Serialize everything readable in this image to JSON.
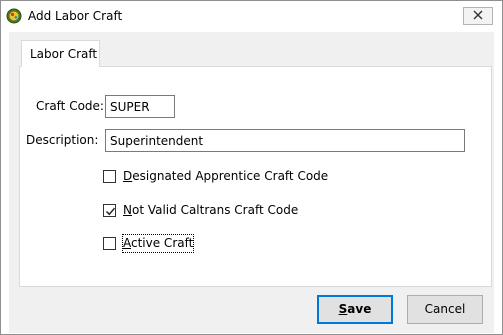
{
  "window": {
    "title": "Add Labor Craft",
    "app_icon": "app-icon",
    "close_icon": "close-icon"
  },
  "tabs": [
    {
      "label": "Labor Craft",
      "selected": true
    }
  ],
  "form": {
    "craft_code": {
      "label": "Craft Code:",
      "value": "SUPER"
    },
    "description": {
      "label": "Description:",
      "value": "Superintendent"
    },
    "checkboxes": [
      {
        "label_mnemonic": "D",
        "label_rest": "esignated Apprentice Craft Code",
        "checked": false
      },
      {
        "label_mnemonic": "N",
        "label_rest": "ot Valid Caltrans Craft Code",
        "checked": true
      },
      {
        "label_mnemonic": "A",
        "label_rest": "ctive Craft",
        "checked": false,
        "focused": true
      }
    ]
  },
  "buttons": {
    "save_mnemonic": "S",
    "save_rest": "ave",
    "cancel": "Cancel"
  },
  "colors": {
    "default_button_border": "#0078d7",
    "client_background": "#f0f0f0",
    "panel_background": "#ffffff"
  }
}
